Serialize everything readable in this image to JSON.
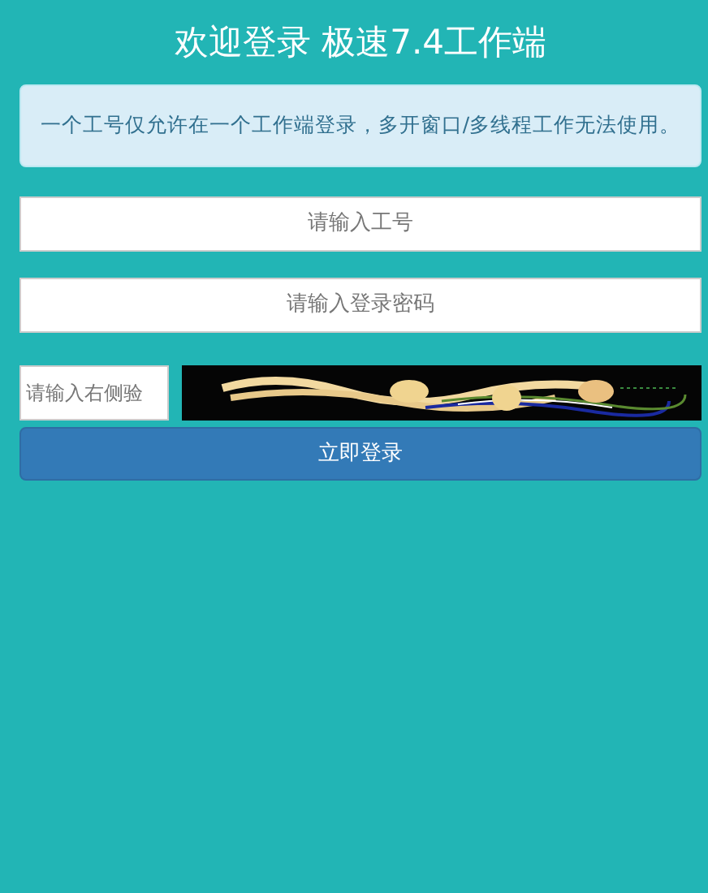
{
  "title": "欢迎登录 极速7.4工作端",
  "notice": "一个工号仅允许在一个工作端登录，多开窗口/多线程工作无法使用。",
  "fields": [
    {
      "placeholder": "请输入工号"
    },
    {
      "placeholder": "请输入登录密码"
    }
  ],
  "captcha": {
    "placeholder": "请输入右侧验",
    "kind": "picture"
  },
  "login_button": "立即登录"
}
